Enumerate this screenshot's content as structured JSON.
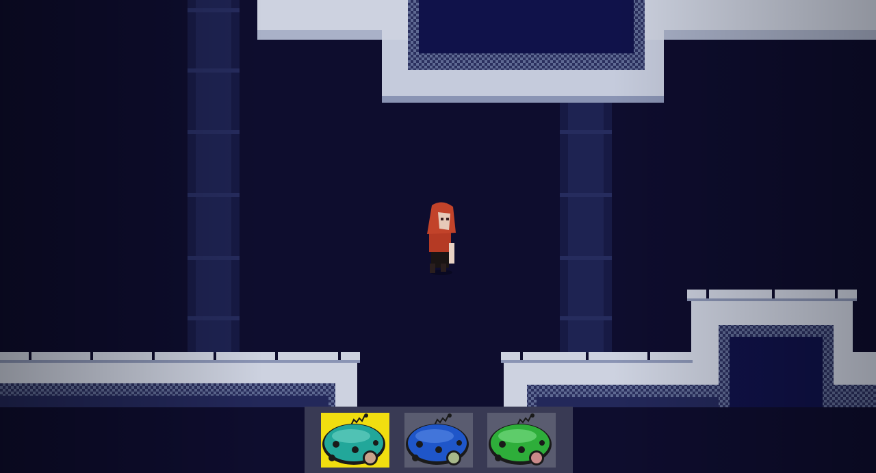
{
  "scene": {
    "background": "#0e0d2e",
    "stone_color": "#cdd2e0",
    "stone_shadow": "#7d88aa",
    "pillar_color": "#1b1f4a",
    "character": {
      "name": "red-hooded-girl",
      "hood_color": "#c2432a"
    }
  },
  "hotbar": {
    "selected_index": 0,
    "slots": [
      {
        "item": "robot-vacuum-teal-icon",
        "color": "#22a79a",
        "selected": true
      },
      {
        "item": "robot-vacuum-blue-icon",
        "color": "#1f56c9",
        "selected": false
      },
      {
        "item": "robot-vacuum-green-icon",
        "color": "#2eae3a",
        "selected": false
      }
    ]
  }
}
